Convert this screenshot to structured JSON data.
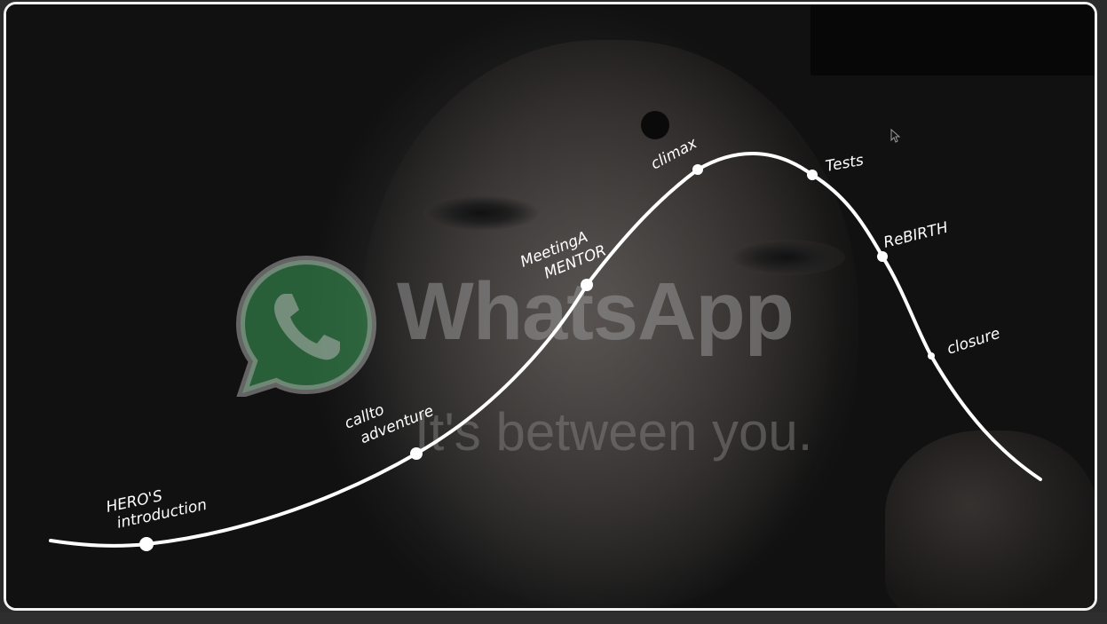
{
  "video": {
    "brand_name": "WhatsApp",
    "tagline": "It's between you.",
    "brand_color": "#25d366",
    "frame_border_color": "#f2f2f2"
  },
  "story_arc": {
    "line_color": "#ffffff",
    "stages": [
      {
        "line1": "HERO'S",
        "line2": "introduction"
      },
      {
        "line1": "callto",
        "line2": "adventure"
      },
      {
        "line1": "MeetingA",
        "line2": "MENTOR"
      },
      {
        "line1": "climax",
        "line2": ""
      },
      {
        "line1": "Tests",
        "line2": ""
      },
      {
        "line1": "ReBIRTH",
        "line2": ""
      },
      {
        "line1": "closure",
        "line2": ""
      }
    ]
  },
  "icons": {
    "logo": "whatsapp-logo-icon",
    "cursor": "mouse-pointer-icon"
  }
}
